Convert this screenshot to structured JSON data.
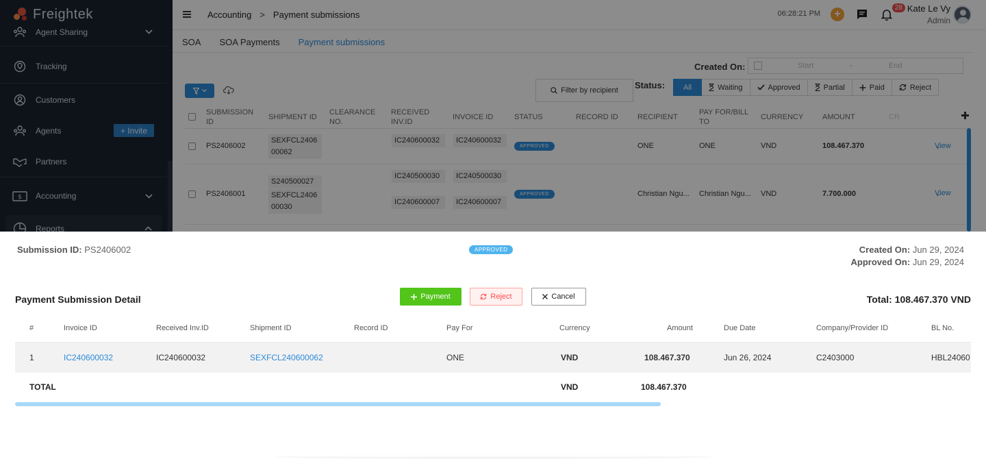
{
  "app": {
    "logo": "Freightek"
  },
  "sidebar": {
    "items": [
      {
        "label": "Agent Sharing",
        "icon": "agent-sharing-icon"
      },
      {
        "label": "Tracking",
        "icon": "tracking-icon"
      },
      {
        "label": "Customers",
        "icon": "customers-icon"
      },
      {
        "label": "Agents",
        "icon": "agents-icon",
        "invite": "+ Invite"
      },
      {
        "label": "Partners",
        "icon": "handshake-icon"
      },
      {
        "label": "Accounting",
        "icon": "accounting-icon"
      },
      {
        "label": "Reports",
        "icon": "reports-icon"
      }
    ]
  },
  "header": {
    "breadcrumb": [
      "Accounting",
      "Payment submissions"
    ],
    "breadcrumb_sep": ">",
    "clock": "06:28:21 PM",
    "notifications": "28",
    "user_name": "Kate Le Vy",
    "user_role": "Admin"
  },
  "tabs": [
    {
      "label": "SOA",
      "active": false
    },
    {
      "label": "SOA Payments",
      "active": false
    },
    {
      "label": "Payment submissions",
      "active": true
    }
  ],
  "filters": {
    "created_on_label": "Created On:",
    "start_placeholder": "Start",
    "range_sep": "-",
    "end_placeholder": "End",
    "recipient_button": "Filter by recipient",
    "status_label": "Status:",
    "status_options": [
      "All",
      "Waiting",
      "Approved",
      "Partial",
      "Paid",
      "Reject"
    ]
  },
  "table": {
    "headers": {
      "submission_id": "SUBMISSION ID",
      "shipment_id": "SHIPMENT ID",
      "clearance_no": "CLEARANCE NO.",
      "received_inv": "RECEIVED INV.ID",
      "invoice_id": "INVOICE ID",
      "status": "STATUS",
      "record_id": "RECORD ID",
      "recipient": "RECIPIENT",
      "pay_for": "PAY FOR/BILL TO",
      "currency": "CURRENCY",
      "amount": "AMOUNT",
      "cr": "CR"
    },
    "rows": [
      {
        "submission_id": "PS2406002",
        "shipments": [
          "SEXFCL240600062"
        ],
        "received": [
          "IC240600032"
        ],
        "invoices": [
          "IC240600032"
        ],
        "status": "APPROVED",
        "recipient": "ONE",
        "pay_for": "ONE",
        "currency": "VND",
        "amount": "108.467.370",
        "action": "View"
      },
      {
        "submission_id": "PS2406001",
        "shipments": [
          "S240500027",
          "SEXFCL240600030"
        ],
        "received": [
          "IC240500030",
          "IC240600007"
        ],
        "invoices": [
          "IC240500030",
          "IC240600007"
        ],
        "status": "APPROVED",
        "recipient": "Christian Ngu...",
        "pay_for": "Christian Ngu...",
        "currency": "VND",
        "amount": "7.700.000",
        "action": "View"
      }
    ]
  },
  "drawer": {
    "submission_id_label": "Submission ID:",
    "submission_id": "PS2406002",
    "status": "APPROVED",
    "created_on_label": "Created On:",
    "created_on": "Jun 29, 2024",
    "approved_on_label": "Approved On:",
    "approved_on": "Jun 29, 2024",
    "title": "Payment Submission Detail",
    "payment_button": "Payment",
    "reject_button": "Reject",
    "cancel_button": "Cancel",
    "total_label": "Total: 108.467.370 VND",
    "columns": {
      "index": "#",
      "invoice_id": "Invoice ID",
      "received_inv": "Received Inv.ID",
      "shipment_id": "Shipment ID",
      "record_id": "Record ID",
      "pay_for": "Pay For",
      "currency": "Currency",
      "amount": "Amount",
      "due_date": "Due Date",
      "company": "Company/Provider ID",
      "bl_no": "BL No."
    },
    "row": {
      "index": "1",
      "invoice_id": "IC240600032",
      "received_inv": "IC240600032",
      "shipment_id": "SEXFCL240600062",
      "record_id": "",
      "pay_for": "ONE",
      "currency": "VND",
      "amount": "108.467.370",
      "due_date": "Jun 26, 2024",
      "company": "C2403000",
      "bl_no": "HBL24060"
    },
    "total_row": {
      "label": "TOTAL",
      "currency": "VND",
      "amount": "108.467.370"
    }
  },
  "colors": {
    "accent": "#2d8ad8",
    "success": "#52c41a",
    "danger": "#ff4d4f",
    "sidebar": "#1b2430"
  }
}
